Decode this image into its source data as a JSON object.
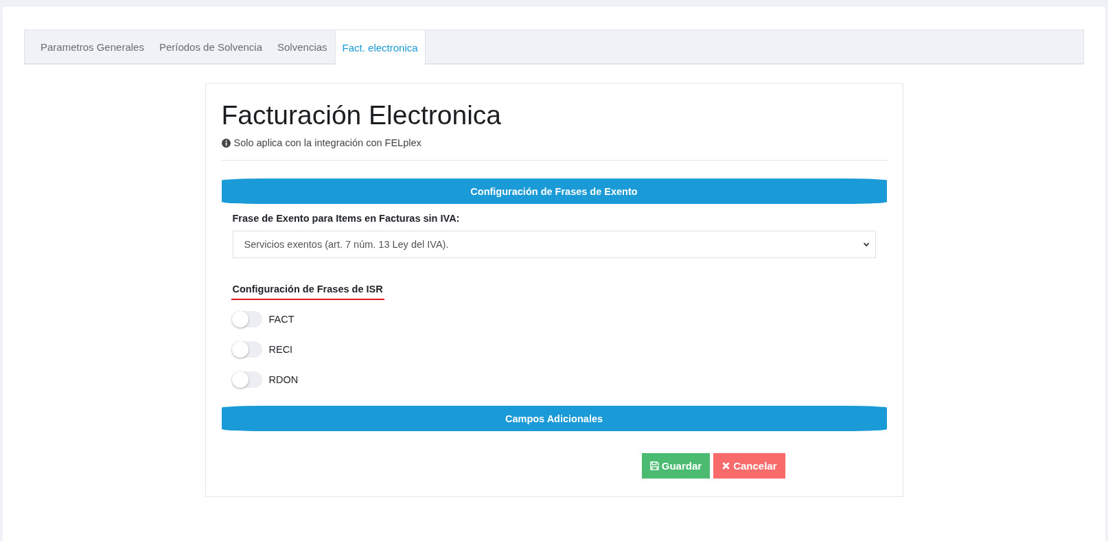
{
  "tabs": [
    {
      "label": "Parametros Generales",
      "selected": false
    },
    {
      "label": "Períodos de Solvencia",
      "selected": false
    },
    {
      "label": "Solvencias",
      "selected": false
    },
    {
      "label": "Fact. electronica",
      "selected": true
    }
  ],
  "panel": {
    "title": "Facturación Electronica",
    "note": "Solo aplica con la integración con FELplex",
    "section_exento": {
      "title": "Configuración de Frases de Exento",
      "field_label": "Frase de Exento para Items en Facturas sin IVA:",
      "select_value": "Servicios exentos (art. 7 núm. 13 Ley del IVA)."
    },
    "section_isr": {
      "title": "Configuración de Frases de ISR",
      "toggles": [
        {
          "label": "FACT",
          "on": false
        },
        {
          "label": "RECI",
          "on": false
        },
        {
          "label": "RDON",
          "on": false
        }
      ]
    },
    "section_campos": {
      "title": "Campos Adicionales"
    },
    "buttons": [
      {
        "kind": "save",
        "label": "Guardar"
      },
      {
        "kind": "cancel",
        "label": "Cancelar"
      }
    ]
  }
}
